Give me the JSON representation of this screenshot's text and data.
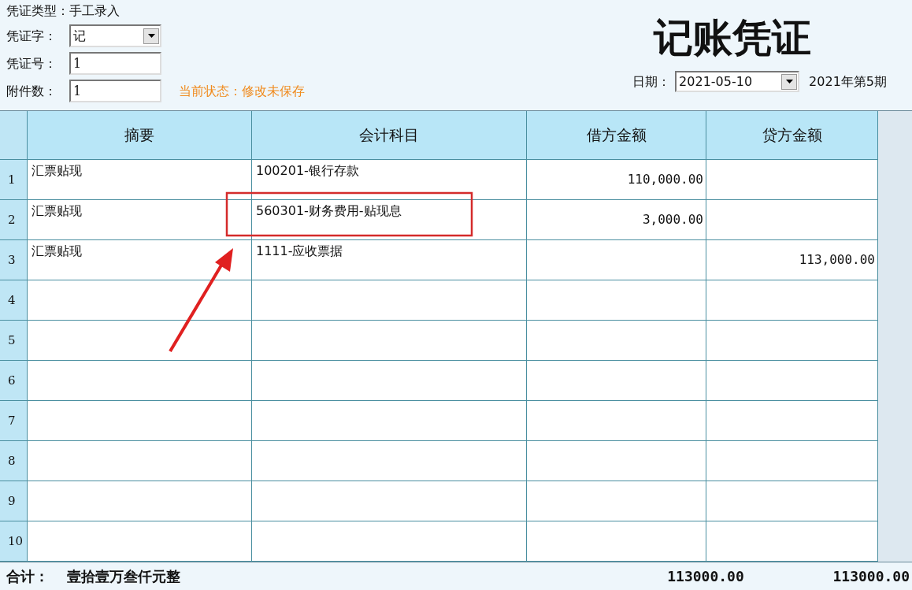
{
  "voucher_type": {
    "label": "凭证类型：",
    "value": "手工录入"
  },
  "fields": [
    {
      "kind": "select",
      "label": "凭证字：",
      "value": "记"
    },
    {
      "kind": "input",
      "label": "凭证号：",
      "value": "1"
    },
    {
      "kind": "input",
      "label": "附件数：",
      "value": "1"
    }
  ],
  "status": "当前状态：修改未保存",
  "title": "记账凭证",
  "date": {
    "label": "日期：",
    "value": "2021-05-10"
  },
  "period": "2021年第5期",
  "table": {
    "columns": [
      "摘要",
      "会计科目",
      "借方金额",
      "贷方金额"
    ],
    "rows": [
      {
        "number": "1",
        "summary": "汇票贴现",
        "account": "100201-银行存款",
        "debit": "110,000.00"
      },
      {
        "number": "2",
        "summary": "汇票贴现",
        "account": "560301-财务费用-贴现息",
        "debit": "3,000.00"
      },
      {
        "number": "3",
        "summary": "汇票贴现",
        "account": "1111-应收票据",
        "credit": "113,000.00"
      },
      {
        "number": "4"
      },
      {
        "number": "5"
      },
      {
        "number": "6"
      },
      {
        "number": "7"
      },
      {
        "number": "8"
      },
      {
        "number": "9"
      },
      {
        "number": "10"
      }
    ]
  },
  "total": {
    "label": "合计：",
    "amount_in_words": "壹拾壹万叁仟元整",
    "debit": "113000.00",
    "credit": "113000.00"
  }
}
